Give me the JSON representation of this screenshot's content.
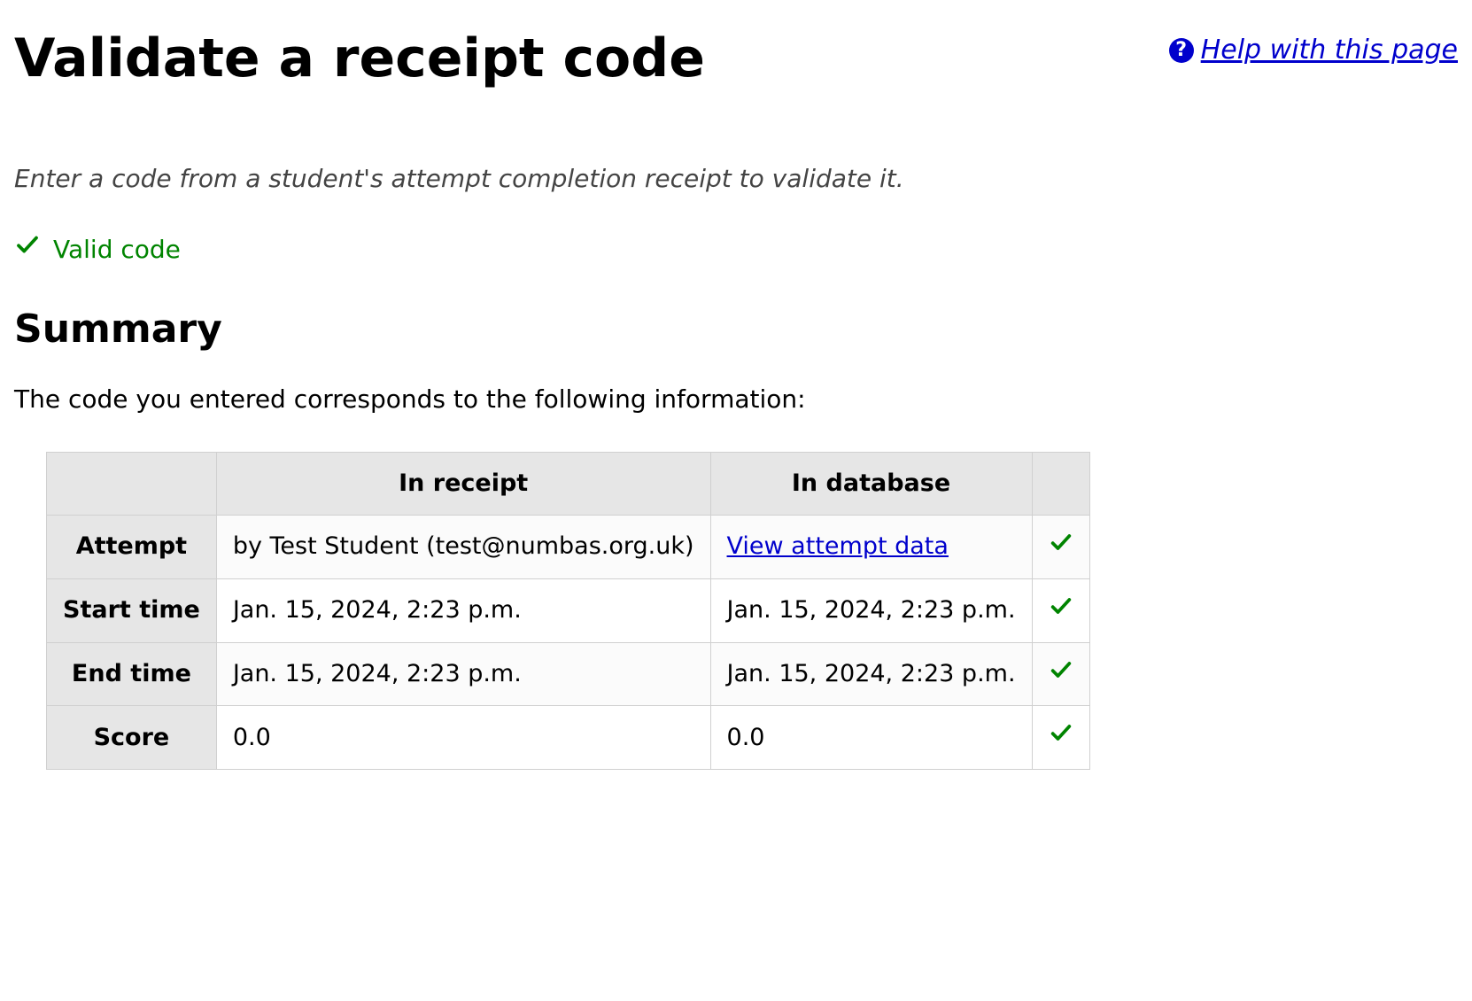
{
  "header": {
    "title": "Validate a receipt code",
    "help_label": " Help with this page"
  },
  "intro": "Enter a code from a student's attempt completion receipt to validate it.",
  "status": {
    "label": "Valid code"
  },
  "summary": {
    "heading": "Summary",
    "intro": "The code you entered corresponds to the following information:",
    "columns": {
      "blank": "",
      "in_receipt": "In receipt",
      "in_database": "In database",
      "match": ""
    },
    "rows": [
      {
        "label": "Attempt",
        "in_receipt": "by Test Student (test@numbas.org.uk)",
        "in_database_link": "View attempt data",
        "match": true
      },
      {
        "label": "Start time",
        "in_receipt": "Jan. 15, 2024, 2:23 p.m.",
        "in_database": "Jan. 15, 2024, 2:23 p.m.",
        "match": true
      },
      {
        "label": "End time",
        "in_receipt": "Jan. 15, 2024, 2:23 p.m.",
        "in_database": "Jan. 15, 2024, 2:23 p.m.",
        "match": true
      },
      {
        "label": "Score",
        "in_receipt": "0.0",
        "in_database": "0.0",
        "match": true
      }
    ]
  }
}
